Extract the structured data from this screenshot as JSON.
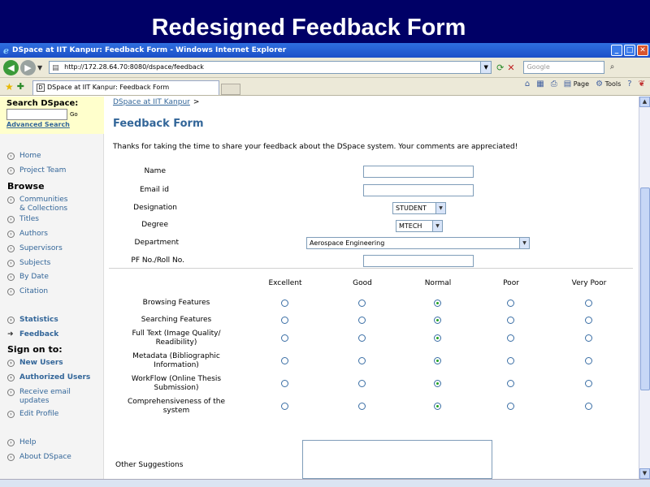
{
  "slide_title": "Redesigned Feedback Form",
  "browser": {
    "window_title": "DSpace at IIT Kanpur: Feedback Form - Windows Internet Explorer",
    "address": "http://172.28.64.70:8080/dspace/feedback",
    "search_placeholder": "Google",
    "tab_label": "DSpace at IIT Kanpur: Feedback Form",
    "cmd_page": "Page",
    "cmd_tools": "Tools"
  },
  "sidebar": {
    "search_title": "Search DSpace:",
    "go_label": "Go",
    "advanced_search": "Advanced Search",
    "home": "Home",
    "project_team": "Project Team",
    "browse_head": "Browse",
    "communities_1": "Communities",
    "communities_2": "& Collections",
    "titles": "Titles",
    "authors": "Authors",
    "supervisors": "Supervisors",
    "subjects": "Subjects",
    "by_date": "By Date",
    "citation": "Citation",
    "statistics": "Statistics",
    "feedback": "Feedback",
    "sign_on_head": "Sign on to:",
    "new_users": "New Users",
    "authorized_users": "Authorized Users",
    "receive_email_1": "Receive email",
    "receive_email_2": "updates",
    "edit_profile": "Edit Profile",
    "help": "Help",
    "about": "About DSpace"
  },
  "main": {
    "breadcrumb": "DSpace at IIT Kanpur",
    "breadcrumb_sep": ">",
    "heading": "Feedback Form",
    "intro": "Thanks for taking the time to share your feedback about the DSpace system. Your comments are appreciated!",
    "fields": {
      "name": "Name",
      "email": "Email id",
      "designation": "Designation",
      "designation_value": "STUDENT",
      "degree": "Degree",
      "degree_value": "MTECH",
      "department": "Department",
      "department_value": "Aerospace Engineering",
      "pf_roll": "PF No./Roll No."
    },
    "rating_columns": [
      "Excellent",
      "Good",
      "Normal",
      "Poor",
      "Very Poor"
    ],
    "rating_rows": [
      {
        "label_1": "Browsing Features",
        "label_2": "",
        "selected": 2
      },
      {
        "label_1": "Searching Features",
        "label_2": "",
        "selected": 2
      },
      {
        "label_1": "Full Text (Image Quality/",
        "label_2": "Readibility)",
        "selected": 2
      },
      {
        "label_1": "Metadata (Bibliographic",
        "label_2": "Information)",
        "selected": 2
      },
      {
        "label_1": "WorkFlow (Online Thesis",
        "label_2": "Submission)",
        "selected": 2
      },
      {
        "label_1": "Comprehensiveness of the",
        "label_2": "system",
        "selected": 2
      }
    ],
    "other_suggestions": "Other Suggestions"
  }
}
